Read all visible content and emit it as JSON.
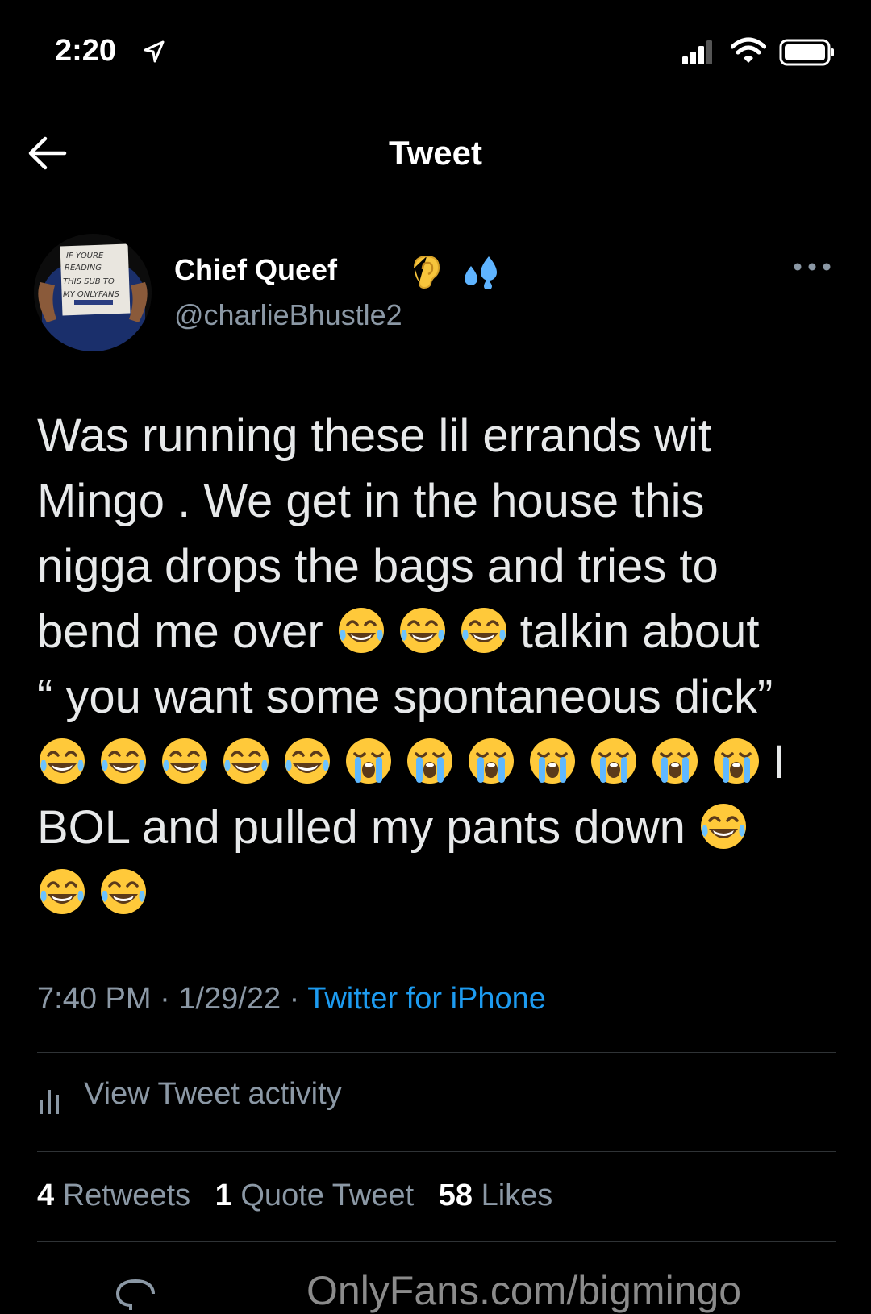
{
  "status_bar": {
    "time": "2:20",
    "icons": [
      "location-arrow-icon",
      "signal-bars-icon",
      "wifi-icon",
      "battery-icon"
    ]
  },
  "nav": {
    "title": "Tweet",
    "back_icon": "back-arrow-icon"
  },
  "author": {
    "display_name": "Chief Queef",
    "name_emojis": [
      "ear-emoji",
      "sweat-droplets-emoji"
    ],
    "handle": "@charlieBhustle2",
    "avatar_sign_text": [
      "IF YOURE",
      "READING",
      "THIS SUB TO",
      "MY ONLYFANS"
    ]
  },
  "tweet": {
    "lines": [
      {
        "segments": [
          {
            "t": "Was running these lil errands wit"
          }
        ]
      },
      {
        "segments": [
          {
            "t": "Mingo . We get in the house this"
          }
        ]
      },
      {
        "segments": [
          {
            "t": "nigga drops the bags and tries to"
          }
        ]
      },
      {
        "segments": [
          {
            "t": "bend me over "
          },
          {
            "e": "joy"
          },
          {
            "e": "joy"
          },
          {
            "e": "joy"
          },
          {
            "t": "talkin about"
          }
        ]
      },
      {
        "segments": [
          {
            "t": "“ you want some spontaneous dick”"
          }
        ]
      },
      {
        "segments": [
          {
            "e": "joy"
          },
          {
            "e": "joy"
          },
          {
            "e": "joy"
          },
          {
            "e": "joy"
          },
          {
            "e": "joy"
          },
          {
            "e": "sob"
          },
          {
            "e": "sob"
          },
          {
            "e": "sob"
          },
          {
            "e": "sob"
          },
          {
            "e": "sob"
          },
          {
            "e": "sob"
          },
          {
            "e": "sob"
          },
          {
            "t": "I"
          }
        ]
      },
      {
        "segments": [
          {
            "t": "BOL and pulled my pants down "
          },
          {
            "e": "joy"
          }
        ]
      },
      {
        "segments": [
          {
            "e": "joy"
          },
          {
            "e": "joy"
          }
        ]
      }
    ]
  },
  "meta": {
    "time": "7:40 PM",
    "date": "1/29/22",
    "separator": " · ",
    "source": "Twitter for iPhone"
  },
  "activity": {
    "label": "View Tweet activity"
  },
  "stats": {
    "retweets_count": "4",
    "retweets_label": "Retweets",
    "quotes_count": "1",
    "quotes_label": "Quote Tweet",
    "likes_count": "58",
    "likes_label": "Likes"
  },
  "watermark": "OnlyFans.com/bigmingo",
  "colors": {
    "background": "#000000",
    "text": "#e7e9ea",
    "secondary": "#8b98a5",
    "link": "#1d9bf0"
  }
}
